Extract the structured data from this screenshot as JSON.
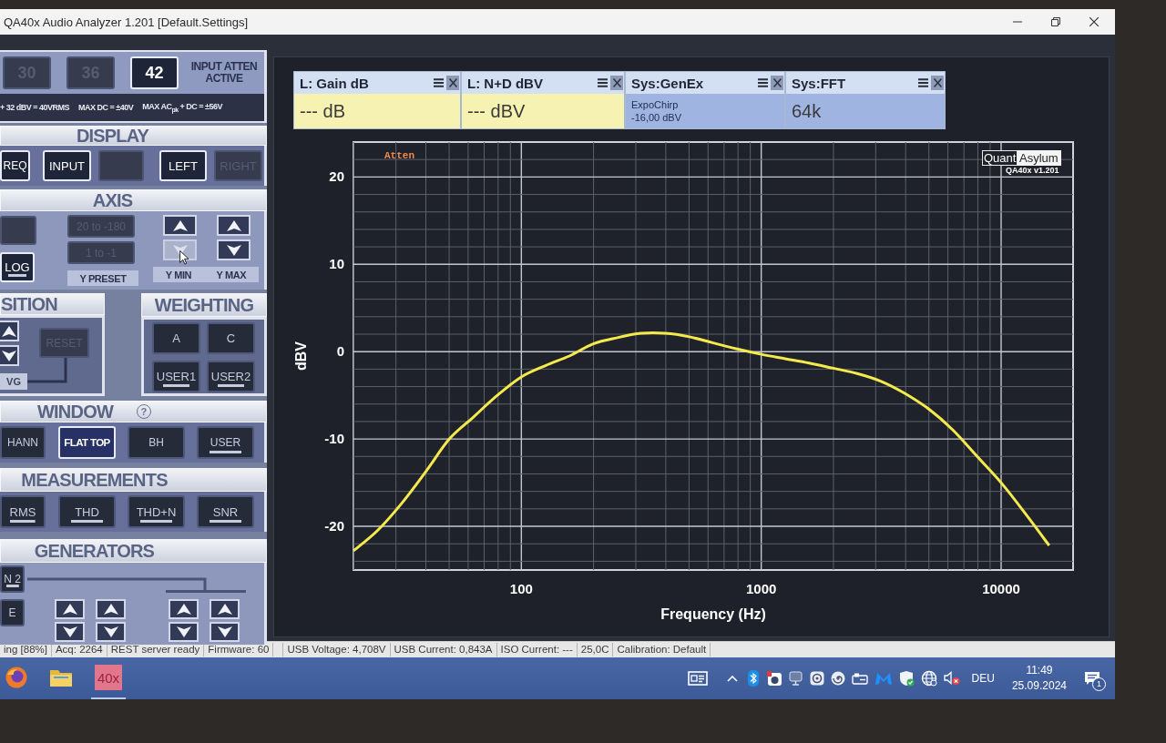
{
  "window": {
    "title": "QA40x Audio Analyzer 1.201 [Default.Settings]"
  },
  "attenuator": {
    "buttons": [
      {
        "label": "30",
        "selected": false,
        "disabled": true
      },
      {
        "label": "36",
        "selected": false,
        "disabled": true
      },
      {
        "label": "42",
        "selected": true,
        "disabled": false
      }
    ],
    "status": "INPUT ATTEN ACTIVE",
    "notes": [
      "+ 32 dBV = 40VRMS",
      "MAX DC = ±40V",
      "MAX AC$_{pk}$ + DC = ±56V"
    ]
  },
  "display": {
    "title": "DISPLAY",
    "buttons": [
      {
        "label": "REQ",
        "selected": true,
        "disabled": false
      },
      {
        "label": "INPUT",
        "selected": true,
        "disabled": false
      },
      {
        "selected": false,
        "disabled": true
      },
      {
        "label": "LEFT",
        "selected": true,
        "disabled": false
      },
      {
        "label": "RIGHT",
        "selected": false,
        "disabled": true
      }
    ]
  },
  "axis": {
    "title": "AXIS",
    "buttons": [
      {
        "selected": false,
        "disabled": true,
        "underline": false
      },
      {
        "label": "LOG",
        "selected": true,
        "disabled": false,
        "underline": true
      }
    ],
    "presets": [
      {
        "label": "20 to -180",
        "selected": false,
        "disabled": true
      },
      {
        "label": "1 to -1",
        "selected": false,
        "disabled": true
      }
    ],
    "preset_label": "Y PRESET",
    "limits": [
      {
        "label": "Y MIN",
        "arrows": [
          {
            "kind": "up",
            "highlighted": false
          },
          {
            "kind": "down",
            "highlighted": true
          }
        ]
      },
      {
        "label": "Y MAX",
        "arrows": [
          {
            "kind": "up",
            "highlighted": false
          },
          {
            "kind": "down",
            "highlighted": false
          }
        ]
      }
    ]
  },
  "position": {
    "title": "SITION",
    "arrows": [
      {
        "kind": "up",
        "highlighted": false
      },
      {
        "kind": "down",
        "highlighted": false
      }
    ],
    "reset": {
      "label": "RESET",
      "disabled": true
    },
    "averaging_label": "VG"
  },
  "weighting": {
    "title": "WEIGHTING",
    "buttons": [
      {
        "label": "A",
        "selected": false,
        "underline": false
      },
      {
        "label": "C",
        "selected": false,
        "underline": false
      },
      {
        "label": "USER1",
        "selected": false,
        "underline": true
      },
      {
        "label": "USER2",
        "selected": false,
        "underline": true
      }
    ]
  },
  "window_function": {
    "title": "WINDOW",
    "help": "?",
    "buttons": [
      {
        "label": "HANN",
        "selected": false,
        "underline": false
      },
      {
        "label": "FLAT TOP",
        "selected": true,
        "underline": false
      },
      {
        "label": "BH",
        "selected": false,
        "underline": false
      },
      {
        "label": "USER",
        "selected": false,
        "underline": true
      }
    ]
  },
  "measurements": {
    "title": "MEASUREMENTS",
    "buttons": [
      {
        "label": "RMS",
        "selected": false,
        "underline": true
      },
      {
        "label": "THD",
        "selected": false,
        "underline": true
      },
      {
        "label": "THD+N",
        "selected": false,
        "underline": true
      },
      {
        "label": "SNR",
        "selected": false,
        "underline": true
      }
    ]
  },
  "generators": {
    "title": "GENERATORS",
    "buttons": [
      {
        "label": "N 2",
        "selected": false,
        "underline": true
      },
      {
        "label": "E",
        "selected": false,
        "underline": false
      }
    ],
    "steppers": [
      {
        "arrows": [
          {
            "kind": "up",
            "highlighted": false
          },
          {
            "kind": "down",
            "highlighted": false
          }
        ]
      },
      {
        "arrows": [
          {
            "kind": "up",
            "highlighted": false
          },
          {
            "kind": "down",
            "highlighted": false
          }
        ]
      },
      {
        "arrows": [
          {
            "kind": "up",
            "highlighted": false
          },
          {
            "kind": "down",
            "highlighted": false
          }
        ]
      },
      {
        "arrows": [
          {
            "kind": "up",
            "highlighted": false
          },
          {
            "kind": "down",
            "highlighted": false
          }
        ]
      }
    ]
  },
  "readouts": [
    {
      "title": "L: Gain dB",
      "kind": "value",
      "value": "--- dB",
      "color": "#f6f2b2"
    },
    {
      "title": "L: N+D dBV",
      "kind": "value",
      "value": "--- dBV",
      "color": "#f6f2b2"
    },
    {
      "title": "Sys:GenEx",
      "kind": "detail",
      "lines": [
        "ExpoChirp",
        "-16,00 dBV"
      ],
      "color": "#9fb4e0"
    },
    {
      "title": "Sys:FFT",
      "kind": "value",
      "value": "64k",
      "color": "#9fb4e0"
    }
  ],
  "chart": {
    "tag": "Atten",
    "logo": [
      "Quant",
      "Asylum"
    ],
    "version": "QA40x v1.201",
    "chart_data": {
      "type": "line",
      "xlabel": "Frequency (Hz)",
      "ylabel": "dBV",
      "categories": [
        null,
        null,
        null,
        null,
        null,
        null,
        null,
        "100",
        null,
        null,
        null,
        null,
        null,
        null,
        null,
        null,
        null,
        "1000",
        null,
        null,
        null,
        null,
        null,
        null,
        null,
        null,
        null,
        "10000",
        null,
        null,
        null
      ],
      "series": [
        {
          "color": "#f4ea4c",
          "values": [
            -22.8,
            -20.5,
            -17.4,
            -13.8,
            -10.0,
            -7.5,
            -5.0,
            -2.9,
            -1.6,
            -0.5,
            0.9,
            1.6,
            2.1,
            2.1,
            1.7,
            1.0,
            0.3,
            -0.3,
            -0.8,
            -1.3,
            -1.9,
            -2.5,
            -3.4,
            -4.8,
            -6.6,
            -9.0,
            -12.0,
            -15.0,
            -18.5,
            -22.2,
            null
          ]
        }
      ],
      "ylim": [
        -25,
        24
      ],
      "yticks": [
        20,
        10,
        0,
        -10,
        -20
      ],
      "grid": true
    }
  },
  "status_bar": {
    "items": [
      "ing [88%]",
      "Acq: 2264",
      "REST server ready",
      "Firmware: 60",
      "USB Voltage: 4,708V",
      "USB Current: 0,843A",
      "ISO Current: ---",
      "25,0C",
      "Calibration: Default"
    ]
  },
  "taskbar": {
    "apps": [
      {
        "kind": "browser",
        "active": false
      },
      {
        "kind": "folder",
        "active": false
      },
      {
        "kind": "tile",
        "label": "40x",
        "active": true
      }
    ],
    "language": "DEU",
    "time": "11:49",
    "date": "25.09.2024",
    "notifications": "1"
  }
}
